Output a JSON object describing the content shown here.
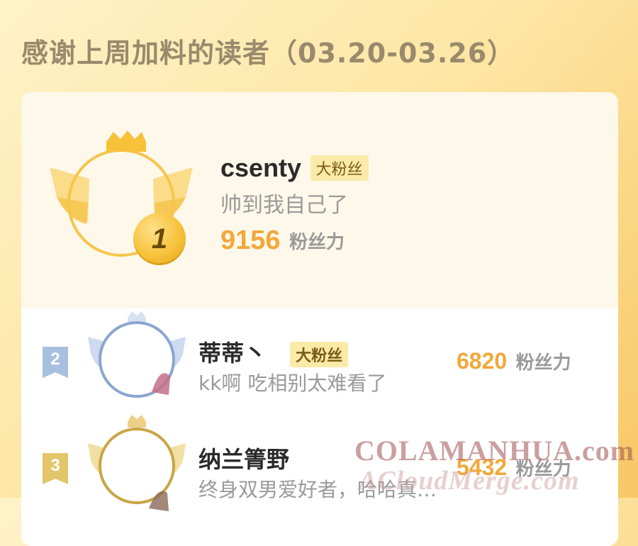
{
  "header": {
    "title": "感谢上周加料的读者（03.20-03.26）"
  },
  "top_fan": {
    "rank": "1",
    "name": "csenty",
    "badge": "大粉丝",
    "comment": "帅到我自己了",
    "score": "9156",
    "score_unit": "粉丝力"
  },
  "fans": [
    {
      "rank": "2",
      "name": "蒂蒂丶",
      "badge": "大粉丝",
      "comment": "kk啊 吃相别太难看了",
      "score": "6820",
      "score_unit": "粉丝力"
    },
    {
      "rank": "3",
      "name": "纳兰箐野",
      "comment": "终身双男爱好者，哈哈真…",
      "score": "5432",
      "score_unit": "粉丝力"
    }
  ],
  "watermark": {
    "line1": "COLAMANHUA.com",
    "line2": "ACloudMerge.com"
  },
  "colors": {
    "accent": "#f2a83a",
    "gold": "#f7c23a",
    "silver": "#9bb3d6",
    "bronze": "#d9b65a"
  },
  "icons": [
    "crown-icon",
    "wing-icon",
    "medal-icon",
    "rank-flag-icon"
  ]
}
